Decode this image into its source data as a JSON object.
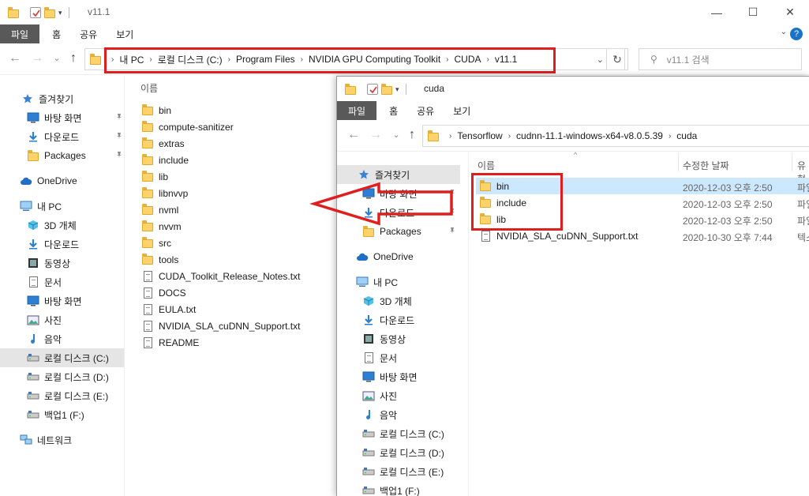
{
  "back_window": {
    "title": "v11.1",
    "ribbon_tabs": [
      "파일",
      "홈",
      "공유",
      "보기"
    ],
    "nav_back": "←",
    "nav_forward": "→",
    "nav_recent": "⌄",
    "nav_up": "↑",
    "breadcrumb": [
      "내 PC",
      "로컬 디스크 (C:)",
      "Program Files",
      "NVIDIA GPU Computing Toolkit",
      "CUDA",
      "v11.1"
    ],
    "address_dropdown": "⌄",
    "refresh": "↻",
    "search_placeholder": "v11.1 검색",
    "column_name": "이름",
    "sidebar": [
      {
        "label": "즐겨찾기",
        "icon": "star-icon",
        "pinned": false
      },
      {
        "label": "바탕 화면",
        "icon": "desktop-icon",
        "pinned": true
      },
      {
        "label": "다운로드",
        "icon": "download-icon",
        "pinned": true
      },
      {
        "label": "Packages",
        "icon": "folder-icon",
        "pinned": true
      },
      {
        "label": "OneDrive",
        "icon": "cloud-icon",
        "pinned": false
      },
      {
        "label": "내 PC",
        "icon": "pc-icon",
        "pinned": false
      },
      {
        "label": "3D 개체",
        "icon": "cube-icon",
        "pinned": false
      },
      {
        "label": "다운로드",
        "icon": "download-icon",
        "pinned": false
      },
      {
        "label": "동영상",
        "icon": "video-icon",
        "pinned": false
      },
      {
        "label": "문서",
        "icon": "document-icon",
        "pinned": false
      },
      {
        "label": "바탕 화면",
        "icon": "desktop-icon",
        "pinned": false
      },
      {
        "label": "사진",
        "icon": "picture-icon",
        "pinned": false
      },
      {
        "label": "음악",
        "icon": "music-icon",
        "pinned": false
      },
      {
        "label": "로컬 디스크 (C:)",
        "icon": "drive-icon",
        "pinned": false
      },
      {
        "label": "로컬 디스크 (D:)",
        "icon": "drive-icon",
        "pinned": false
      },
      {
        "label": "로컬 디스크 (E:)",
        "icon": "drive-icon",
        "pinned": false
      },
      {
        "label": "백업1 (F:)",
        "icon": "drive-icon",
        "pinned": false
      },
      {
        "label": "네트워크",
        "icon": "network-icon",
        "pinned": false
      }
    ],
    "files": [
      {
        "name": "bin",
        "type": "folder"
      },
      {
        "name": "compute-sanitizer",
        "type": "folder"
      },
      {
        "name": "extras",
        "type": "folder"
      },
      {
        "name": "include",
        "type": "folder"
      },
      {
        "name": "lib",
        "type": "folder"
      },
      {
        "name": "libnvvp",
        "type": "folder"
      },
      {
        "name": "nvml",
        "type": "folder"
      },
      {
        "name": "nvvm",
        "type": "folder"
      },
      {
        "name": "src",
        "type": "folder"
      },
      {
        "name": "tools",
        "type": "folder"
      },
      {
        "name": "CUDA_Toolkit_Release_Notes.txt",
        "type": "file"
      },
      {
        "name": "DOCS",
        "type": "file"
      },
      {
        "name": "EULA.txt",
        "type": "file"
      },
      {
        "name": "NVIDIA_SLA_cuDNN_Support.txt",
        "type": "file"
      },
      {
        "name": "README",
        "type": "file"
      }
    ]
  },
  "front_window": {
    "title": "cuda",
    "ribbon_tabs": [
      "파일",
      "홈",
      "공유",
      "보기"
    ],
    "nav_back": "←",
    "nav_forward": "→",
    "nav_recent": "⌄",
    "nav_up": "↑",
    "breadcrumb": [
      "Tensorflow",
      "cudnn-11.1-windows-x64-v8.0.5.39",
      "cuda"
    ],
    "columns": [
      "이름",
      "수정한 날짜",
      "유형"
    ],
    "sidebar": [
      {
        "label": "즐겨찾기",
        "icon": "star-icon",
        "pinned": false
      },
      {
        "label": "바탕 화면",
        "icon": "desktop-icon",
        "pinned": true
      },
      {
        "label": "다운로드",
        "icon": "download-icon",
        "pinned": true
      },
      {
        "label": "Packages",
        "icon": "folder-icon",
        "pinned": true
      },
      {
        "label": "OneDrive",
        "icon": "cloud-icon",
        "pinned": false
      },
      {
        "label": "내 PC",
        "icon": "pc-icon",
        "pinned": false
      },
      {
        "label": "3D 개체",
        "icon": "cube-icon",
        "pinned": false
      },
      {
        "label": "다운로드",
        "icon": "download-icon",
        "pinned": false
      },
      {
        "label": "동영상",
        "icon": "video-icon",
        "pinned": false
      },
      {
        "label": "문서",
        "icon": "document-icon",
        "pinned": false
      },
      {
        "label": "바탕 화면",
        "icon": "desktop-icon",
        "pinned": false
      },
      {
        "label": "사진",
        "icon": "picture-icon",
        "pinned": false
      },
      {
        "label": "음악",
        "icon": "music-icon",
        "pinned": false
      },
      {
        "label": "로컬 디스크 (C:)",
        "icon": "drive-icon",
        "pinned": false
      },
      {
        "label": "로컬 디스크 (D:)",
        "icon": "drive-icon",
        "pinned": false
      },
      {
        "label": "로컬 디스크 (E:)",
        "icon": "drive-icon",
        "pinned": false
      },
      {
        "label": "백업1 (F:)",
        "icon": "drive-icon",
        "pinned": false
      }
    ],
    "files": [
      {
        "name": "bin",
        "type": "folder",
        "date": "2020-12-03 오후 2:50",
        "kind": "파일"
      },
      {
        "name": "include",
        "type": "folder",
        "date": "2020-12-03 오후 2:50",
        "kind": "파일"
      },
      {
        "name": "lib",
        "type": "folder",
        "date": "2020-12-03 오후 2:50",
        "kind": "파일"
      },
      {
        "name": "NVIDIA_SLA_cuDNN_Support.txt",
        "type": "file",
        "date": "2020-10-30 오후 7:44",
        "kind": "텍스"
      }
    ]
  },
  "colors": {
    "annotation_red": "#e01e1e",
    "selected_row": "#cce8ff",
    "ribbon_active": "#595959"
  }
}
